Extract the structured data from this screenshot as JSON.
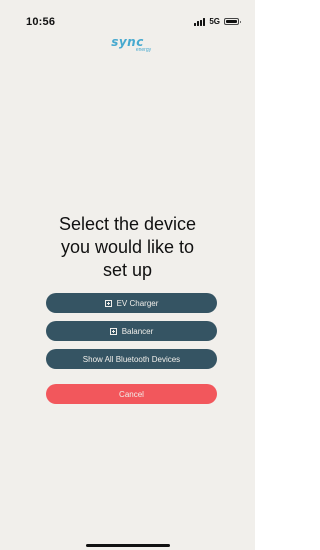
{
  "status_bar": {
    "time": "10:56",
    "network": "5G"
  },
  "logo": {
    "main": "sync",
    "sub": "energy"
  },
  "heading": {
    "line1": "Select the device",
    "line2": "you would like to",
    "line3": "set up"
  },
  "buttons": {
    "ev_charger": "EV Charger",
    "balancer": "Balancer",
    "show_all": "Show All Bluetooth Devices",
    "cancel": "Cancel"
  },
  "colors": {
    "background": "#f1efeb",
    "primary_button": "#355463",
    "cancel_button": "#f2575c",
    "brand": "#46a9cf"
  }
}
